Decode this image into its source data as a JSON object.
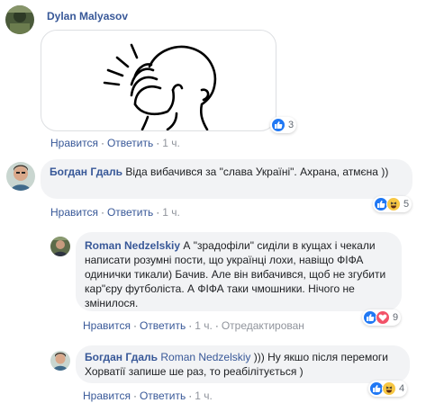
{
  "comments": [
    {
      "author": "Dylan Malyasov",
      "text": "",
      "actions": {
        "like": "Нравится",
        "reply": "Ответить",
        "time": "1 ч."
      },
      "reactions": {
        "count": "3",
        "icons": [
          "like-icon"
        ]
      }
    },
    {
      "author": "Богдан Гдаль",
      "text": "Віда вибачився за \"слава Україні\". Ахрана, атмєна ))",
      "actions": {
        "like": "Нравится",
        "reply": "Ответить",
        "time": "1 ч."
      },
      "reactions": {
        "count": "5",
        "icons": [
          "like-icon",
          "haha-icon"
        ]
      }
    },
    {
      "author": "Roman Nedzelskiy",
      "text": "А \"зрадофіли\" сиділи в кущах і чекали написати розумні пости, що українці лохи, навіщо ФІФА одинички тикали) Бачив. Але він вибачився, щоб не згубити кар\"єру футболіста. А ФІФА таки чмошники. Нічого не змінилося.",
      "actions": {
        "like": "Нравится",
        "reply": "Ответить",
        "time": "1 ч.",
        "edited": "Отредактирован"
      },
      "reactions": {
        "count": "9",
        "icons": [
          "like-icon",
          "love-icon"
        ]
      }
    },
    {
      "author": "Богдан Гдаль",
      "mention": "Roman Nedzelskiy",
      "text": " ))) Ну якшо після перемоги Хорватії запише ше раз, то реабілітується )",
      "actions": {
        "like": "Нравится",
        "reply": "Ответить",
        "time": "1 ч."
      },
      "reactions": {
        "count": "4",
        "icons": [
          "like-icon",
          "haha-icon"
        ]
      }
    }
  ],
  "colors": {
    "link": "#385898",
    "bubble": "#f2f3f5",
    "meta": "#606770",
    "like": "#2078f4",
    "haha": "#f7c744",
    "love": "#f25268"
  }
}
